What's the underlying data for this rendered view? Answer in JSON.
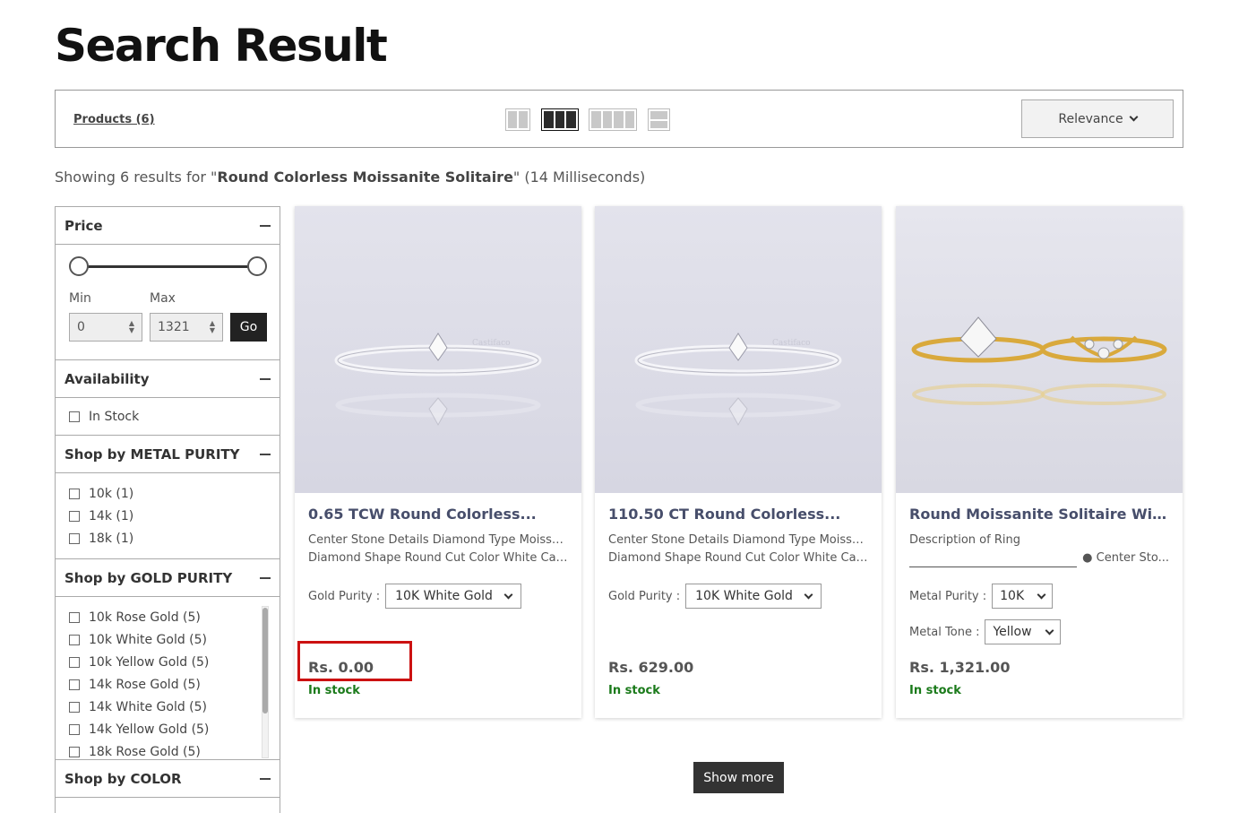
{
  "page": {
    "title": "Search Result"
  },
  "toolbar": {
    "products_label": "Products (6)",
    "sort_value": "Relevance"
  },
  "search": {
    "showing_prefix": "Showing 6 results for \"",
    "query": "Round Colorless Moissanite Solitaire",
    "showing_suffix": "\" (14 Milliseconds)"
  },
  "filters": {
    "price": {
      "title": "Price",
      "min_label": "Min",
      "max_label": "Max",
      "min_value": "0",
      "max_value": "1321",
      "go_label": "Go"
    },
    "availability": {
      "title": "Availability",
      "items": [
        "In Stock"
      ]
    },
    "metal_purity": {
      "title": "Shop by METAL PURITY",
      "items": [
        "10k (1)",
        "14k (1)",
        "18k (1)"
      ]
    },
    "gold_purity": {
      "title": "Shop by GOLD PURITY",
      "items": [
        "10k Rose Gold (5)",
        "10k White Gold (5)",
        "10k Yellow Gold (5)",
        "14k Rose Gold (5)",
        "14k White Gold (5)",
        "14k Yellow Gold (5)",
        "18k Rose Gold (5)"
      ]
    },
    "color": {
      "title": "Shop by COLOR"
    }
  },
  "products": [
    {
      "title": "0.65 TCW Round Colorless...",
      "desc_line1": "Center Stone Details Diamond Type Moissanite",
      "desc_line2": "Diamond Shape Round Cut Color White Car...",
      "option_label": "Gold Purity :",
      "option_value": "10K White Gold",
      "price": "Rs. 0.00",
      "stock": "In stock",
      "watermark": "Castifaco"
    },
    {
      "title": "110.50 CT Round Colorless...",
      "desc_line1": "Center Stone Details Diamond Type Moissanite",
      "desc_line2": "Diamond Shape Round Cut Color White Car...",
      "option_label": "Gold Purity :",
      "option_value": "10K White Gold",
      "price": "Rs. 629.00",
      "stock": "In stock",
      "watermark": "Castifaco"
    },
    {
      "title": "Round Moissanite Solitaire With...",
      "desc_line1": "Description of Ring",
      "desc_line2": "● Center Sto...",
      "option_label": "Metal Purity :",
      "option_value": "10K",
      "option2_label": "Metal Tone :",
      "option2_value": "Yellow",
      "price": "Rs. 1,321.00",
      "stock": "In stock"
    }
  ],
  "show_more_label": "Show more",
  "colors": {
    "accent_dark": "#222222",
    "in_stock": "#1a7a1a",
    "title": "#474e6b",
    "highlight": "#cc1111"
  }
}
